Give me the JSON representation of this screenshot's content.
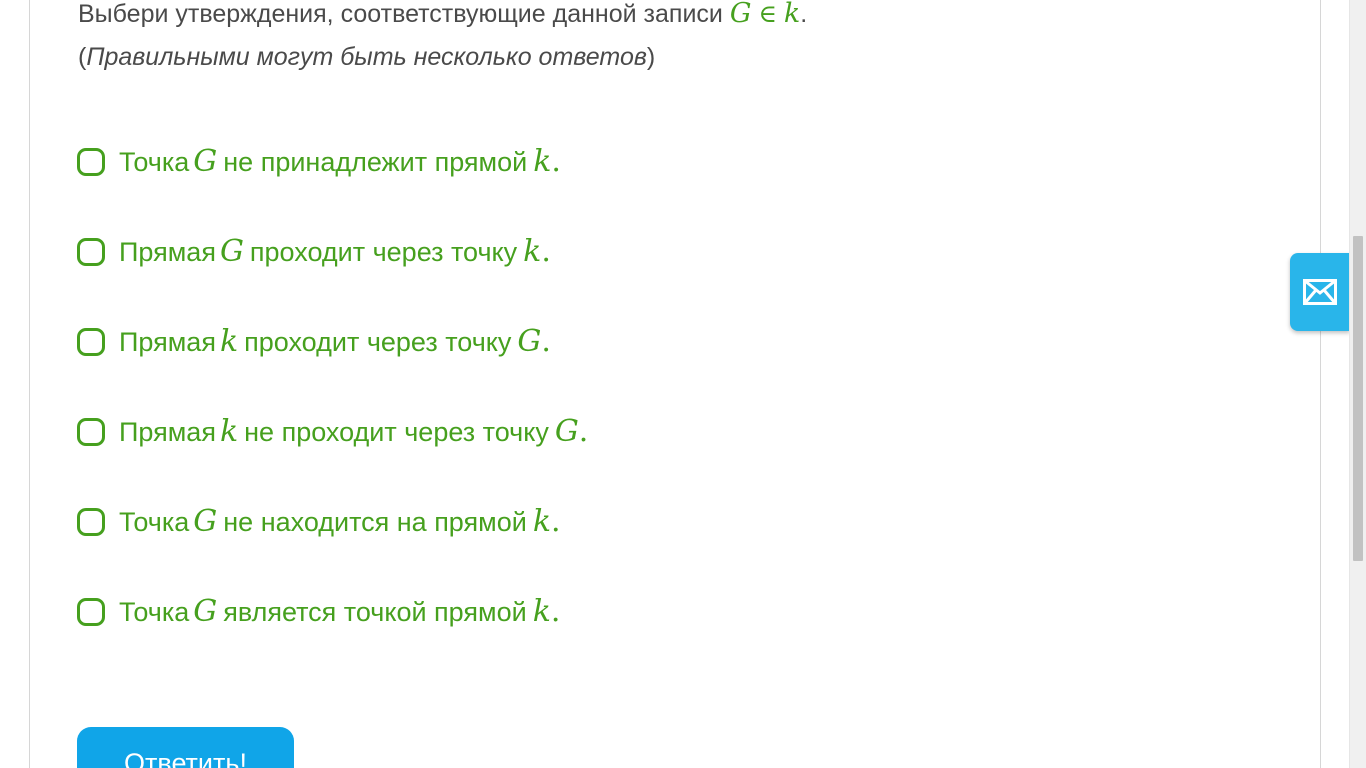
{
  "question": {
    "text_before": "Выбери утверждения, соответствующие данной записи",
    "math_left": "G",
    "math_symbol": "∈",
    "math_right": "k",
    "text_after": "."
  },
  "hint": {
    "open": "(",
    "text": "Правильными могут быть несколько ответов",
    "close": ")"
  },
  "options": [
    {
      "before": "Точка",
      "var1": "G",
      "middle": "не принадлежит прямой",
      "var2": "k",
      "end": ".",
      "checked": false
    },
    {
      "before": "Прямая",
      "var1": "G",
      "middle": "проходит через точку",
      "var2": "k",
      "end": ".",
      "checked": false
    },
    {
      "before": "Прямая",
      "var1": "k",
      "middle": "проходит через точку",
      "var2": "G",
      "end": ".",
      "checked": false
    },
    {
      "before": "Прямая",
      "var1": "k",
      "middle": "не проходит через точку",
      "var2": "G",
      "end": ".",
      "checked": false
    },
    {
      "before": "Точка",
      "var1": "G",
      "middle": "не находится на прямой",
      "var2": "k",
      "end": ".",
      "checked": false
    },
    {
      "before": "Точка",
      "var1": "G",
      "middle": "является точкой прямой",
      "var2": "k",
      "end": ".",
      "checked": false
    }
  ],
  "submit_label": "Ответить!",
  "mail_widget_icon": "envelope-icon",
  "colors": {
    "accent_green": "#46a01e",
    "button_blue": "#10a5e8",
    "widget_blue": "#29b5ea",
    "text_gray": "#4a4a4a"
  }
}
